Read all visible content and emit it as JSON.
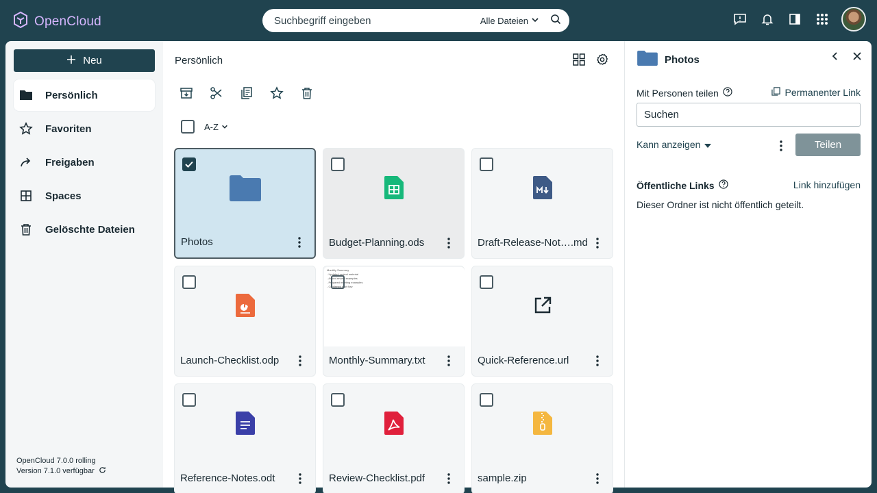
{
  "app": {
    "name": "OpenCloud",
    "brand_color": "#d6b6ff",
    "header_bg": "#20434f"
  },
  "search": {
    "placeholder": "Suchbegriff eingeben",
    "scope": "Alle Dateien"
  },
  "topbar_icons": [
    "feedback-icon",
    "bell-icon",
    "sidebar-toggle-icon",
    "app-grid-icon"
  ],
  "sidebar": {
    "new_label": "Neu",
    "items": [
      {
        "label": "Persönlich",
        "icon": "folder-icon",
        "active": true
      },
      {
        "label": "Favoriten",
        "icon": "star-icon",
        "active": false
      },
      {
        "label": "Freigaben",
        "icon": "share-arrow-icon",
        "active": false
      },
      {
        "label": "Spaces",
        "icon": "spaces-icon",
        "active": false
      },
      {
        "label": "Gelöschte Dateien",
        "icon": "trash-icon",
        "active": false
      }
    ],
    "version_line1": "OpenCloud 7.0.0 rolling",
    "version_line2": "Version 7.1.0 verfügbar"
  },
  "main": {
    "breadcrumb": "Persönlich",
    "sort_label": "A-Z",
    "toolbar": [
      "download-archive-icon",
      "cut-icon",
      "copy-icon",
      "star-icon",
      "trash-icon"
    ],
    "files": [
      {
        "name": "Photos",
        "type": "folder",
        "color": "#4a7ab0",
        "selected": true
      },
      {
        "name": "Budget-Planning.ods",
        "type": "spreadsheet",
        "color": "#16b87a",
        "selected": false
      },
      {
        "name": "Draft-Release-Not….md",
        "type": "markdown",
        "color": "#3e5a86",
        "selected": false
      },
      {
        "name": "Launch-Checklist.odp",
        "type": "presentation",
        "color": "#ec6a3d",
        "selected": false
      },
      {
        "name": "Monthly-Summary.txt",
        "type": "text-preview",
        "color": "#555555",
        "selected": false
      },
      {
        "name": "Quick-Reference.url",
        "type": "link",
        "color": "#1a2a32",
        "selected": false
      },
      {
        "name": "Reference-Notes.odt",
        "type": "document",
        "color": "#3a3fa8",
        "selected": false
      },
      {
        "name": "Review-Checklist.pdf",
        "type": "pdf",
        "color": "#e0203c",
        "selected": false
      },
      {
        "name": "sample.zip",
        "type": "archive",
        "color": "#f4b740",
        "selected": false
      }
    ],
    "txt_preview_lines": [
      "Monthly Summary",
      "- Updated project material",
      "- Added review examples",
      "- Prepared meeting examples",
      "- Confirmed pilot flow"
    ]
  },
  "details": {
    "title": "Photos",
    "share_with_people": "Mit Personen teilen",
    "permanent_link": "Permanenter Link",
    "people_search_placeholder": "Suchen",
    "role": "Kann anzeigen",
    "share_button": "Teilen",
    "public_links": "Öffentliche Links",
    "add_link": "Link hinzufügen",
    "no_public_note": "Dieser Ordner ist nicht öffentlich geteilt."
  }
}
